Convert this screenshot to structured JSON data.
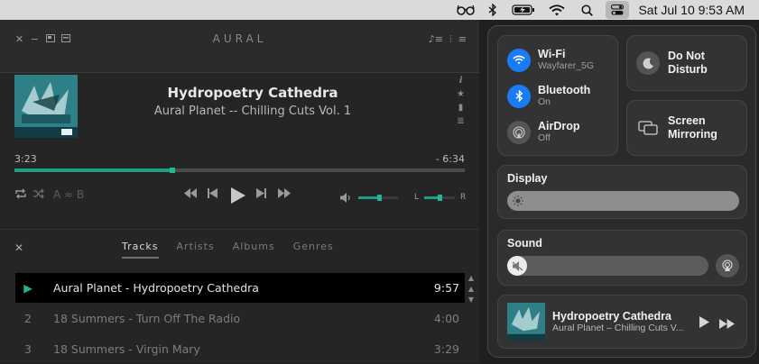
{
  "menubar": {
    "icons": [
      "glasses-icon",
      "bluetooth-icon",
      "battery-charging-icon",
      "wifi-icon",
      "search-icon",
      "control-center-icon"
    ],
    "clock": "Sat Jul 10  9:53 AM"
  },
  "player": {
    "logo": "AURAL",
    "track_title": "Hydropoetry Cathedra",
    "track_subtitle": "Aural Planet -- Chilling Cuts Vol. 1",
    "elapsed": "3:23",
    "remaining": "- 6:34",
    "progress": 0.35,
    "volume": 0.52,
    "balance": 0.5,
    "balance_left": "L",
    "balance_right": "R",
    "ab_label": "A ≈ B",
    "tabs": [
      "Tracks",
      "Artists",
      "Albums",
      "Genres"
    ],
    "active_tab": 0,
    "tracks": [
      {
        "num": "▶",
        "name": "Aural Planet - Hydropoetry Cathedra",
        "duration": "9:57",
        "active": true
      },
      {
        "num": "2",
        "name": "18 Summers - Turn Off The Radio",
        "duration": "4:00",
        "active": false
      },
      {
        "num": "3",
        "name": "18 Summers - Virgin Mary",
        "duration": "3:29",
        "active": false
      }
    ],
    "colors": {
      "accent": "#1e9e87",
      "background": "#252525"
    }
  },
  "control_center": {
    "wifi": {
      "label": "Wi-Fi",
      "status": "Wayfarer_5G"
    },
    "bluetooth": {
      "label": "Bluetooth",
      "status": "On"
    },
    "airdrop": {
      "label": "AirDrop",
      "status": "Off"
    },
    "dnd": {
      "label_line1": "Do Not",
      "label_line2": "Disturb"
    },
    "mirroring": {
      "label_line1": "Screen",
      "label_line2": "Mirroring"
    },
    "display": {
      "label": "Display",
      "level": 1.0
    },
    "sound": {
      "label": "Sound",
      "level": 0.0
    },
    "now_playing": {
      "title": "Hydropoetry Cathedra",
      "subtitle": "Aural Planet – Chilling Cuts V..."
    },
    "colors": {
      "accent": "#1a7cf5"
    }
  }
}
